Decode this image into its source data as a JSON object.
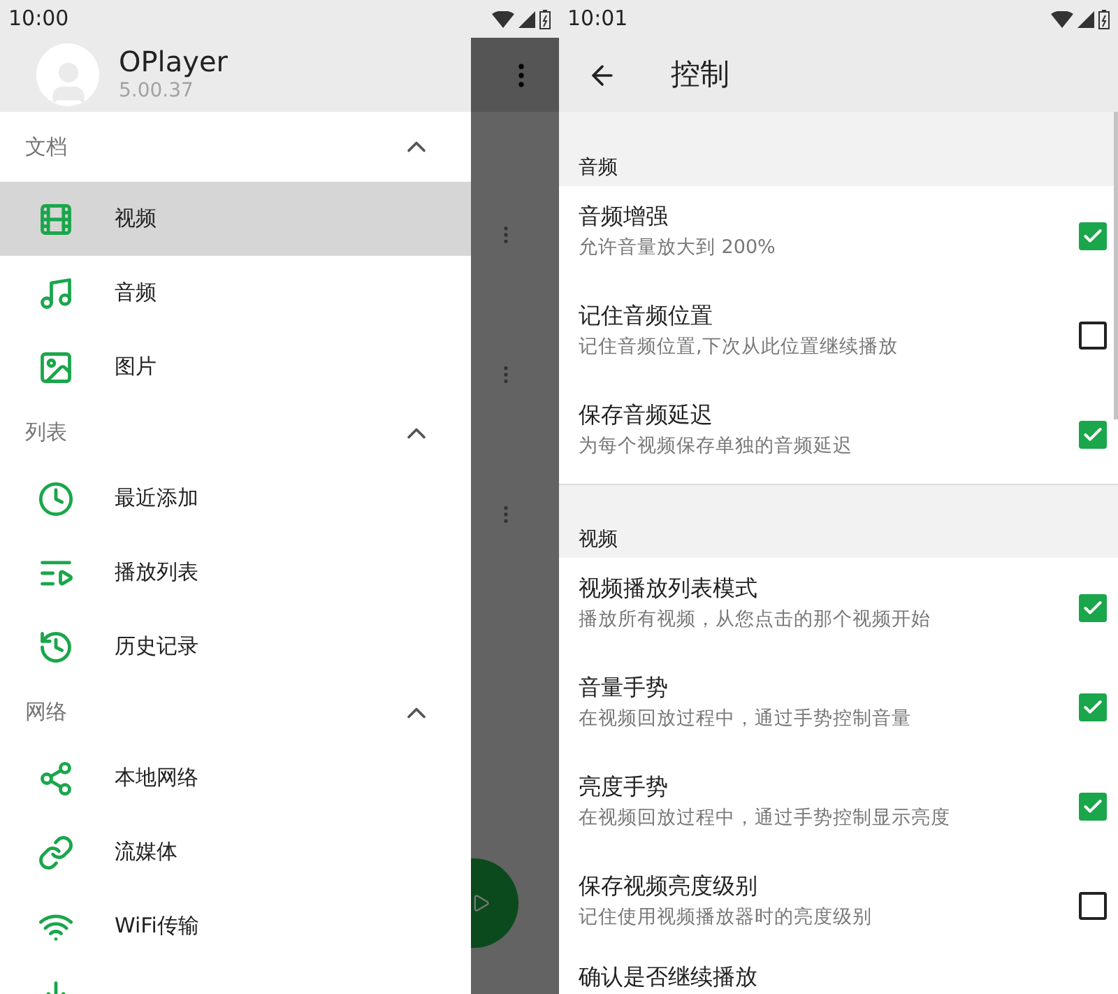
{
  "drawer_screen": {
    "status_bar": {
      "time": "10:00"
    },
    "drawer": {
      "header": {
        "app_name": "OPlayer",
        "version": "5.00.37"
      },
      "sections": [
        {
          "title": "文档",
          "expanded": true,
          "items": [
            {
              "label": "视频",
              "selected": true
            },
            {
              "label": "音频",
              "selected": false
            },
            {
              "label": "图片",
              "selected": false
            }
          ]
        },
        {
          "title": "列表",
          "expanded": true,
          "items": [
            {
              "label": "最近添加",
              "selected": false
            },
            {
              "label": "播放列表",
              "selected": false
            },
            {
              "label": "历史记录",
              "selected": false
            }
          ]
        },
        {
          "title": "网络",
          "expanded": true,
          "items": [
            {
              "label": "本地网络",
              "selected": false
            },
            {
              "label": "流媒体",
              "selected": false
            },
            {
              "label": "WiFi传输",
              "selected": false
            },
            {
              "selected": false
            }
          ]
        }
      ]
    }
  },
  "settings_screen": {
    "status_bar": {
      "time": "10:01"
    },
    "toolbar": {
      "title": "控制"
    },
    "sections": [
      {
        "title": "音频",
        "items": [
          {
            "title": "音频增强",
            "subtitle": "允许音量放大到 200%",
            "checked": true
          },
          {
            "title": "记住音频位置",
            "subtitle": "记住音频位置,下次从此位置继续播放",
            "checked": false
          },
          {
            "title": "保存音频延迟",
            "subtitle": "为每个视频保存单独的音频延迟",
            "checked": true
          }
        ]
      },
      {
        "title": "视频",
        "items": [
          {
            "title": "视频播放列表模式",
            "subtitle": "播放所有视频，从您点击的那个视频开始",
            "checked": true
          },
          {
            "title": "音量手势",
            "subtitle": "在视频回放过程中，通过手势控制音量",
            "checked": true
          },
          {
            "title": "亮度手势",
            "subtitle": "在视频回放过程中，通过手势控制显示亮度",
            "checked": true
          },
          {
            "title": "保存视频亮度级别",
            "subtitle": "记住使用视频播放器时的亮度级别",
            "checked": false
          },
          {
            "title": "确认是否继续播放"
          }
        ]
      }
    ]
  }
}
